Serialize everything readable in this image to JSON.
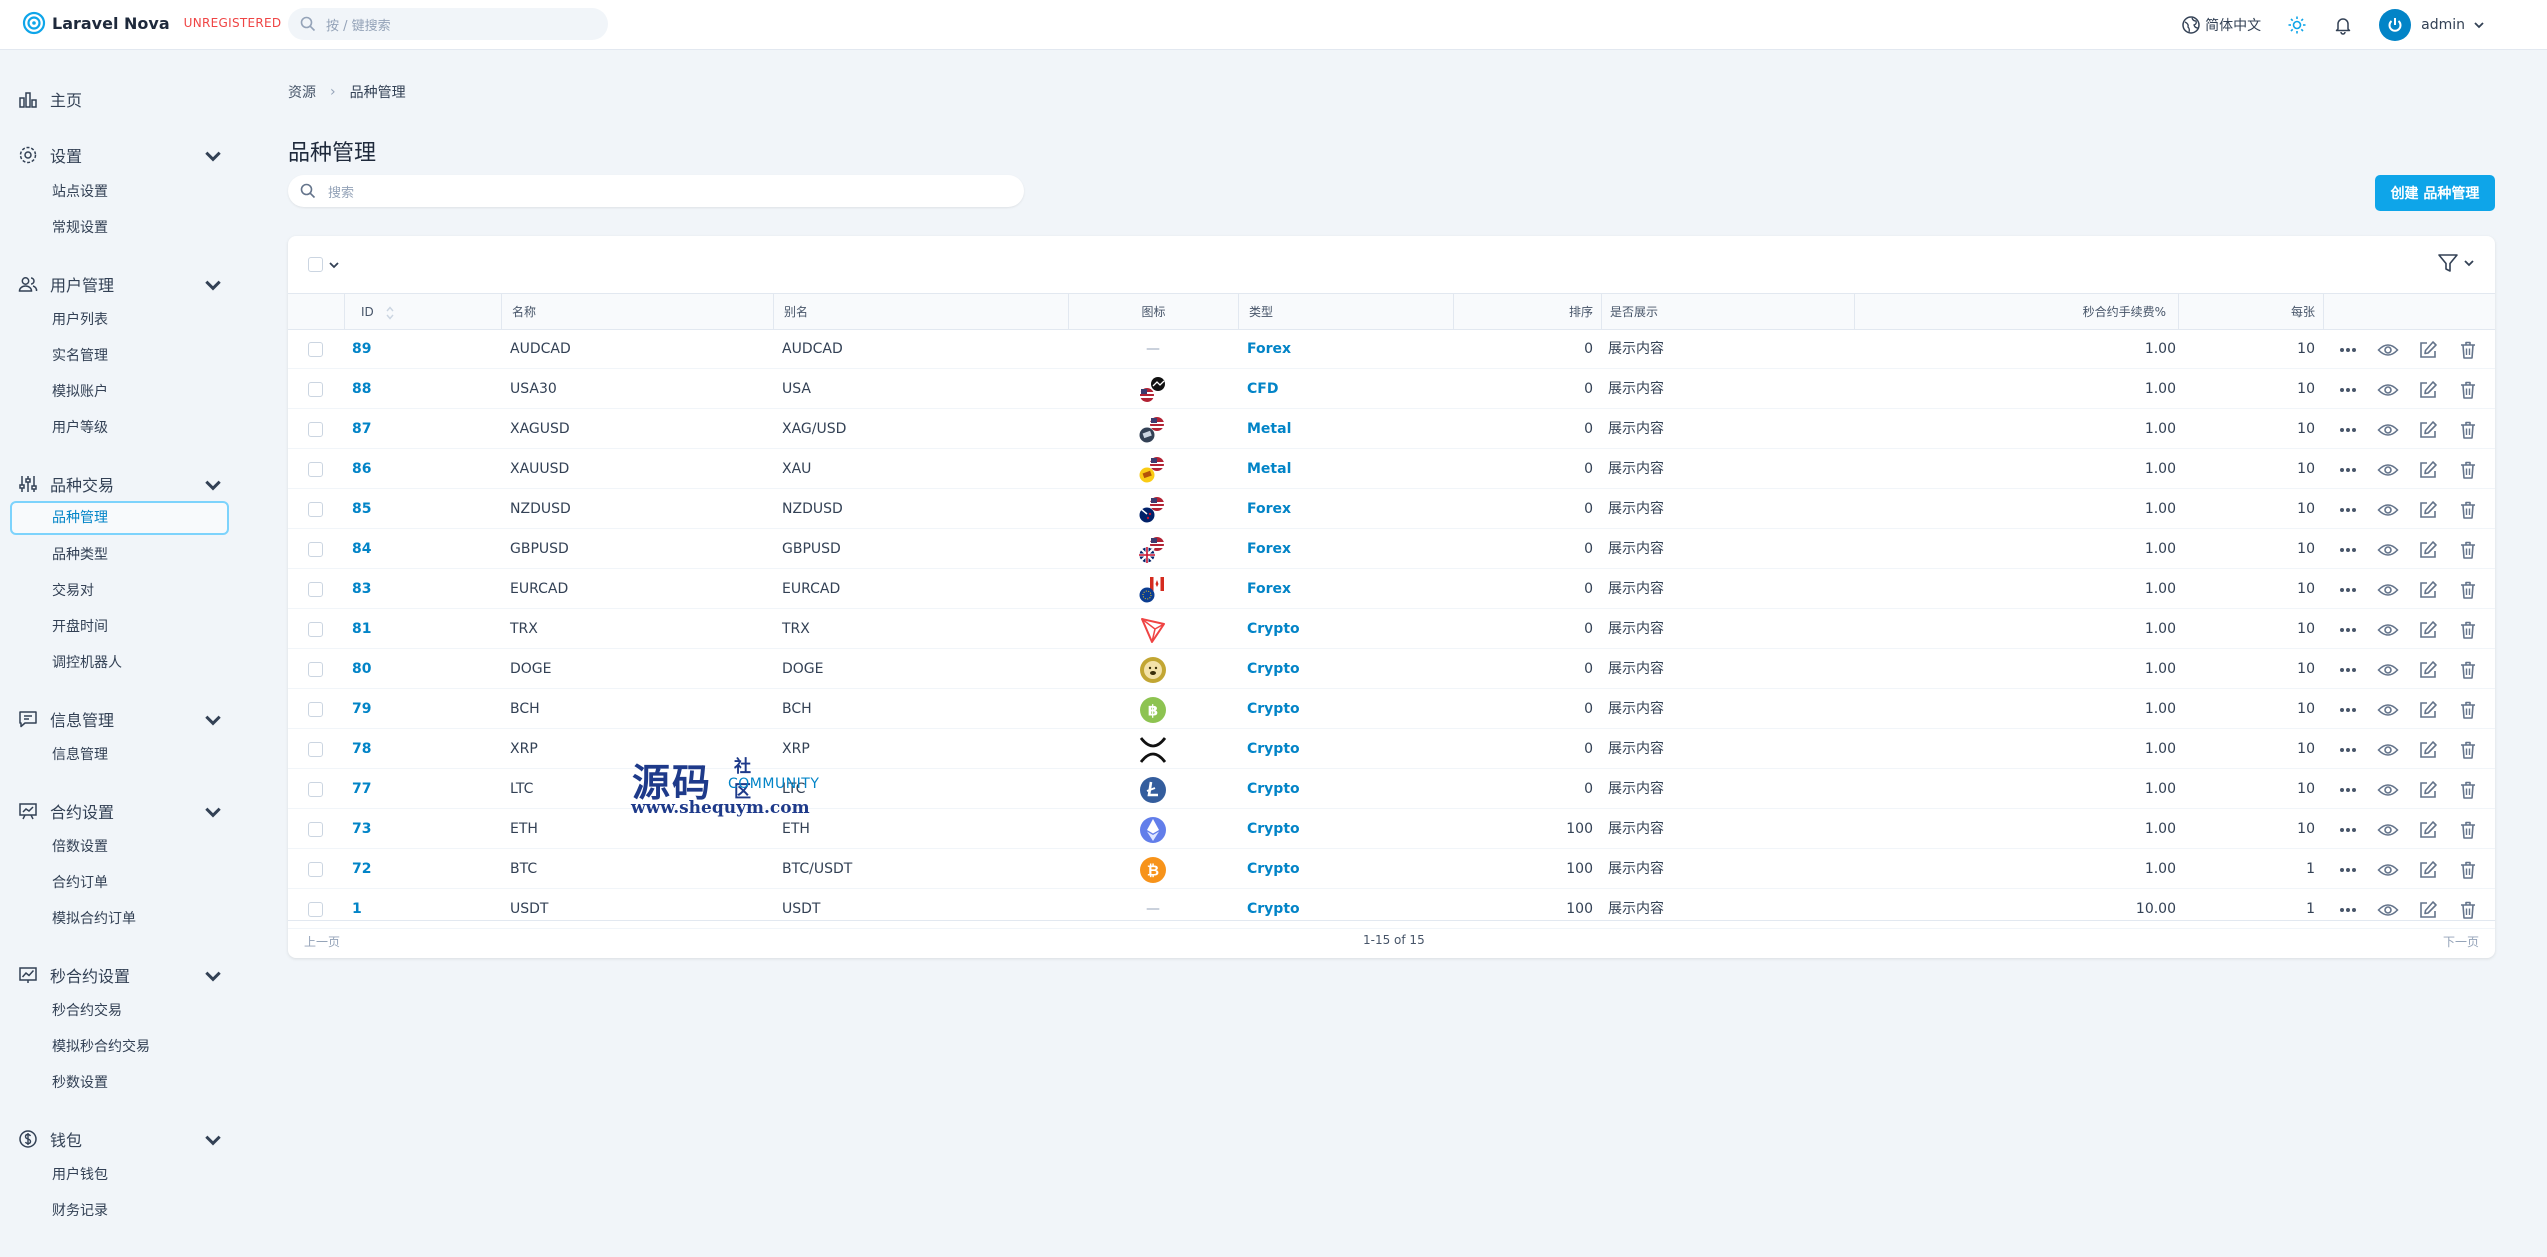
{
  "header": {
    "app_name": "Laravel Nova",
    "badge": "UNREGISTERED",
    "search_placeholder": "按 / 键搜索",
    "language": "简体中文",
    "user": "admin"
  },
  "sidebar": {
    "home": "主页",
    "groups": [
      {
        "label": "设置",
        "items": [
          "站点设置",
          "常规设置"
        ]
      },
      {
        "label": "用户管理",
        "items": [
          "用户列表",
          "实名管理",
          "模拟账户",
          "用户等级"
        ]
      },
      {
        "label": "品种交易",
        "items": [
          "品种管理",
          "品种类型",
          "交易对",
          "开盘时间",
          "调控机器人"
        ]
      },
      {
        "label": "信息管理",
        "items": [
          "信息管理"
        ]
      },
      {
        "label": "合约设置",
        "items": [
          "倍数设置",
          "合约订单",
          "模拟合约订单"
        ]
      },
      {
        "label": "秒合约设置",
        "items": [
          "秒合约交易",
          "模拟秒合约交易",
          "秒数设置"
        ]
      },
      {
        "label": "钱包",
        "items": [
          "用户钱包",
          "财务记录"
        ]
      }
    ],
    "active_item": "品种管理"
  },
  "breadcrumb": {
    "root": "资源",
    "current": "品种管理"
  },
  "page": {
    "title": "品种管理",
    "search_placeholder": "搜索",
    "create_label": "创建 品种管理"
  },
  "table": {
    "columns": [
      "ID",
      "名称",
      "别名",
      "图标",
      "类型",
      "排序",
      "是否展示",
      "秒合约手续费%",
      "每张"
    ],
    "rows": [
      {
        "id": "89",
        "name": "AUDCAD",
        "alias": "AUDCAD",
        "icon": "dash",
        "type": "Forex",
        "sort": "0",
        "show": "展示内容",
        "fee": "1.00",
        "per": "10"
      },
      {
        "id": "88",
        "name": "USA30",
        "alias": "USA",
        "icon": "flag-us-dow-icon",
        "type": "CFD",
        "sort": "0",
        "show": "展示内容",
        "fee": "1.00",
        "per": "10"
      },
      {
        "id": "87",
        "name": "XAGUSD",
        "alias": "XAG/USD",
        "icon": "silver-usd-icon",
        "type": "Metal",
        "sort": "0",
        "show": "展示内容",
        "fee": "1.00",
        "per": "10"
      },
      {
        "id": "86",
        "name": "XAUUSD",
        "alias": "XAU",
        "icon": "gold-usd-icon",
        "type": "Metal",
        "sort": "0",
        "show": "展示内容",
        "fee": "1.00",
        "per": "10"
      },
      {
        "id": "85",
        "name": "NZDUSD",
        "alias": "NZDUSD",
        "icon": "flag-nz-us-icon",
        "type": "Forex",
        "sort": "0",
        "show": "展示内容",
        "fee": "1.00",
        "per": "10"
      },
      {
        "id": "84",
        "name": "GBPUSD",
        "alias": "GBPUSD",
        "icon": "flag-gb-us-icon",
        "type": "Forex",
        "sort": "0",
        "show": "展示内容",
        "fee": "1.00",
        "per": "10"
      },
      {
        "id": "83",
        "name": "EURCAD",
        "alias": "EURCAD",
        "icon": "flag-eu-ca-icon",
        "type": "Forex",
        "sort": "0",
        "show": "展示内容",
        "fee": "1.00",
        "per": "10"
      },
      {
        "id": "81",
        "name": "TRX",
        "alias": "TRX",
        "icon": "tron-icon",
        "type": "Crypto",
        "sort": "0",
        "show": "展示内容",
        "fee": "1.00",
        "per": "10"
      },
      {
        "id": "80",
        "name": "DOGE",
        "alias": "DOGE",
        "icon": "doge-icon",
        "type": "Crypto",
        "sort": "0",
        "show": "展示内容",
        "fee": "1.00",
        "per": "10"
      },
      {
        "id": "79",
        "name": "BCH",
        "alias": "BCH",
        "icon": "bch-icon",
        "type": "Crypto",
        "sort": "0",
        "show": "展示内容",
        "fee": "1.00",
        "per": "10"
      },
      {
        "id": "78",
        "name": "XRP",
        "alias": "XRP",
        "icon": "xrp-icon",
        "type": "Crypto",
        "sort": "0",
        "show": "展示内容",
        "fee": "1.00",
        "per": "10"
      },
      {
        "id": "77",
        "name": "LTC",
        "alias": "LTC",
        "icon": "ltc-icon",
        "type": "Crypto",
        "sort": "0",
        "show": "展示内容",
        "fee": "1.00",
        "per": "10"
      },
      {
        "id": "73",
        "name": "ETH",
        "alias": "ETH",
        "icon": "eth-icon",
        "type": "Crypto",
        "sort": "100",
        "show": "展示内容",
        "fee": "1.00",
        "per": "10"
      },
      {
        "id": "72",
        "name": "BTC",
        "alias": "BTC/USDT",
        "icon": "btc-icon",
        "type": "Crypto",
        "sort": "100",
        "show": "展示内容",
        "fee": "1.00",
        "per": "1"
      },
      {
        "id": "1",
        "name": "USDT",
        "alias": "USDT",
        "icon": "dash",
        "type": "Crypto",
        "sort": "100",
        "show": "展示内容",
        "fee": "10.00",
        "per": "1"
      }
    ]
  },
  "pagination": {
    "prev": "上一页",
    "summary": "1-15 of 15",
    "next": "下一页"
  },
  "watermark": {
    "big": "源码",
    "small": "社区",
    "community": "COMMUNITY",
    "url": "www.shequym.com"
  },
  "colors": {
    "accent": "#0ea5e9",
    "link": "#0284c7",
    "badge": "#ef4444"
  }
}
